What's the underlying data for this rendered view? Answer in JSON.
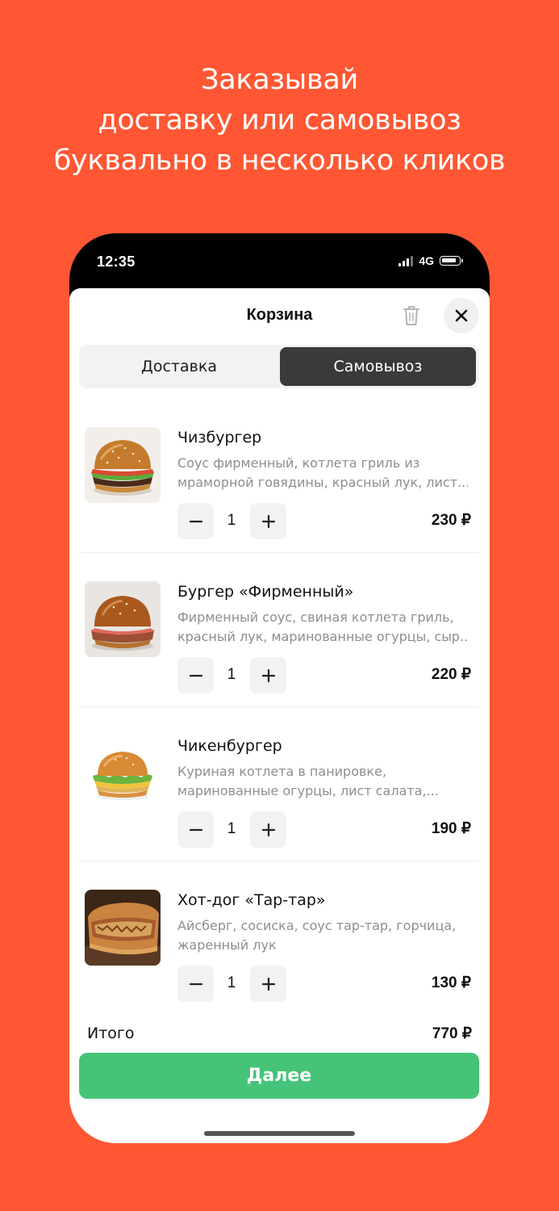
{
  "promo": {
    "line1": "Заказывай",
    "line2": "доставку или самовывоз",
    "line3": "буквально в несколько кликов"
  },
  "status_bar": {
    "time": "12:35",
    "network": "4G"
  },
  "cart": {
    "title": "Корзина",
    "tabs": [
      {
        "label": "Доставка",
        "selected": false
      },
      {
        "label": "Самовывоз",
        "selected": true
      }
    ],
    "items": [
      {
        "name": "Чизбургер",
        "desc_line1": "Соус фирменный, котлета гриль из",
        "desc_line2": "мраморной говядины, красный лук, лист...",
        "quantity": "1",
        "price": "230 ₽"
      },
      {
        "name": "Бургер «Фирменный»",
        "desc_line1": "Фирменный соус, свиная котлета гриль,",
        "desc_line2": "красный лук, маринованные огурцы, сыр...",
        "quantity": "1",
        "price": "220 ₽"
      },
      {
        "name": "Чикенбургер",
        "desc_line1": "Куриная котлета в панировке,",
        "desc_line2": "маринованные огурцы, лист салата,...",
        "quantity": "1",
        "price": "190 ₽"
      },
      {
        "name": "Хот-дог «Тар-тар»",
        "desc_line1": "Айсберг, сосиска, соус тар-тар, горчица,",
        "desc_line2": "жаренный лук",
        "quantity": "1",
        "price": "130 ₽"
      }
    ],
    "total_label": "Итого",
    "total_value": "770 ₽",
    "next_label": "Далее"
  },
  "colors": {
    "background": "#FF5733",
    "primary_button": "#45C479",
    "selected_tab": "#3A3A3A"
  },
  "icons": [
    "signal-icon",
    "battery-icon",
    "trash-icon",
    "close-icon",
    "minus-icon",
    "plus-icon"
  ]
}
